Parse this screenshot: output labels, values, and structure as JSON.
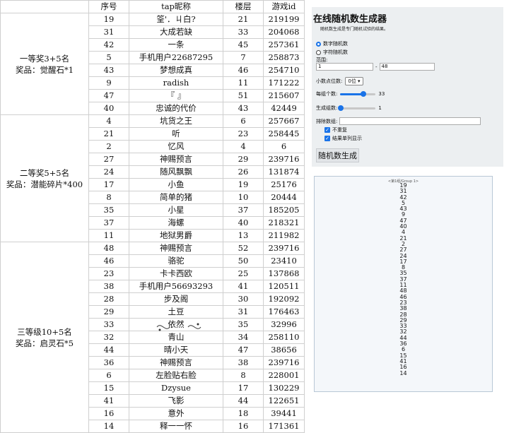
{
  "table": {
    "headers": [
      "序号",
      "tap昵称",
      "楼层",
      "游戏id"
    ],
    "groups": [
      {
        "title": "一等奖3+5名",
        "prize": "奖品：觉醒石*1",
        "rows": [
          [
            "19",
            "筌'．ㄐ白?",
            "21",
            "219199"
          ],
          [
            "31",
            "大成若缺",
            "33",
            "204068"
          ],
          [
            "42",
            "一条",
            "45",
            "257361"
          ],
          [
            "5",
            "手机用户22687295",
            "7",
            "258873"
          ],
          [
            "43",
            "梦想成真",
            "46",
            "254710"
          ],
          [
            "9",
            "radish",
            "11",
            "171222"
          ],
          [
            "47",
            "『 』",
            "51",
            "215607"
          ],
          [
            "40",
            "忠诚的代价",
            "43",
            "42449"
          ]
        ]
      },
      {
        "title": "二等奖5+5名",
        "prize": "奖品：潜能碎片*400",
        "rows": [
          [
            "4",
            "坑货之王",
            "6",
            "257667"
          ],
          [
            "21",
            "听",
            "23",
            "258445"
          ],
          [
            "2",
            "忆风",
            "4",
            "6"
          ],
          [
            "27",
            "神赐预言",
            "29",
            "239716"
          ],
          [
            "24",
            "随风飘飘",
            "26",
            "131874"
          ],
          [
            "17",
            "小鱼",
            "19",
            "25176"
          ],
          [
            "8",
            "简单的猪",
            "10",
            "20444"
          ],
          [
            "35",
            "小星",
            "37",
            "185205"
          ],
          [
            "37",
            "海螺",
            "40",
            "218321"
          ],
          [
            "11",
            "地狱男爵",
            "13",
            "211982"
          ]
        ]
      },
      {
        "title": "三等级10+5名",
        "prize": "奖品：启灵石*5",
        "rows": [
          [
            "48",
            "神赐预言",
            "52",
            "239716"
          ],
          [
            "46",
            "骆驼",
            "50",
            "23410"
          ],
          [
            "23",
            "卡卡西欧",
            "25",
            "137868"
          ],
          [
            "38",
            "手机用户56693293",
            "41",
            "120511"
          ],
          [
            "28",
            "步及阁",
            "30",
            "192092"
          ],
          [
            "29",
            "土豆",
            "31",
            "176463"
          ],
          [
            "33",
            "依然",
            "35",
            "32996"
          ],
          [
            "32",
            "青山",
            "34",
            "258110"
          ],
          [
            "44",
            "晴小天",
            "47",
            "38656"
          ],
          [
            "36",
            "神赐预言",
            "38",
            "239716"
          ],
          [
            "6",
            "左脸贴右脸",
            "8",
            "228001"
          ],
          [
            "15",
            "Dzysue",
            "17",
            "130229"
          ],
          [
            "41",
            "飞影",
            "44",
            "122651"
          ],
          [
            "16",
            "意外",
            "18",
            "39441"
          ],
          [
            "14",
            "释一一怀",
            "16",
            "171361"
          ]
        ]
      }
    ]
  },
  "generator": {
    "title": "在线随机数生成器",
    "subtitle": "随机数生成是专门随机试验的结果。",
    "mode_number": "数字随机数",
    "mode_string": "字符随机数",
    "range_label": "范围:",
    "range_min": "1",
    "range_sep": "-",
    "range_max": "48",
    "decimals_label": "小数点位数:",
    "decimals_value": "0位",
    "count_label": "每组个数:",
    "count_value": "33",
    "count_level": 0.66,
    "groups_label": "生成组数:",
    "groups_value": "1",
    "groups_level": 0.02,
    "exclude_label": "排除数组:",
    "no_repeat_label": "不重复",
    "column_label": "结果单列显示",
    "generate_button": "随机数生成"
  },
  "result": {
    "group_header": "<第1组/Group 1>",
    "numbers": [
      "19",
      "31",
      "42",
      "5",
      "43",
      "9",
      "47",
      "40",
      "4",
      "21",
      "2",
      "27",
      "24",
      "17",
      "8",
      "35",
      "37",
      "11",
      "48",
      "46",
      "23",
      "38",
      "28",
      "29",
      "33",
      "32",
      "44",
      "36",
      "6",
      "15",
      "41",
      "16",
      "14"
    ]
  },
  "colors": {
    "accent": "#1a73e8",
    "panel_bg": "#eceff1",
    "grid": "#cfcfcf"
  }
}
